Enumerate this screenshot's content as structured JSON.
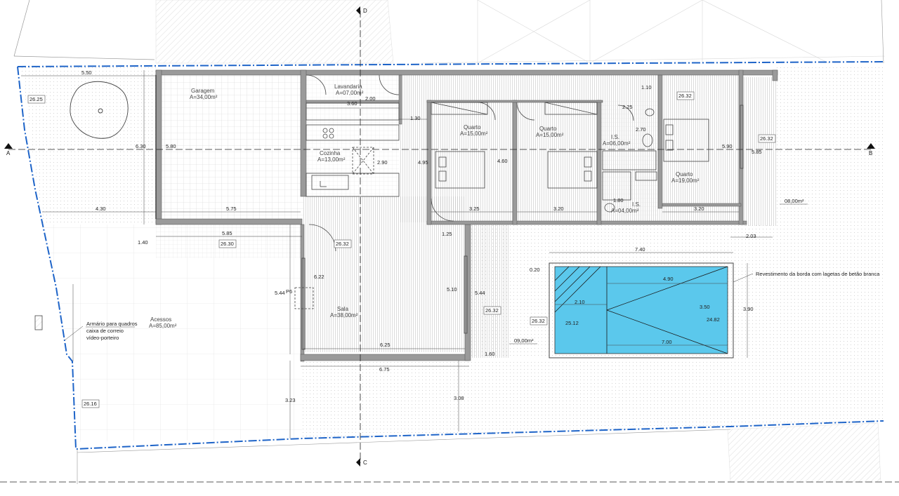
{
  "sections": {
    "a": "A",
    "b": "B",
    "c": "C",
    "d": "D"
  },
  "rooms": {
    "garagem": {
      "name": "Garagem",
      "area": "A=34,00m²"
    },
    "lavandaria": {
      "name": "Lavandaria",
      "area": "A=07,00m²"
    },
    "cozinha": {
      "name": "Cozinha",
      "area": "A=13,00m²"
    },
    "quarto1": {
      "name": "Quarto",
      "area": "A=15,00m²"
    },
    "quarto2": {
      "name": "Quarto",
      "area": "A=15,00m²"
    },
    "is1": {
      "name": "I.S.",
      "area": "A=06,00m²"
    },
    "is2": {
      "name": "I.S.",
      "area": "A=04,00m²"
    },
    "quarto3": {
      "name": "Quarto",
      "area": "A=19,00m²"
    },
    "sala": {
      "name": "Sala",
      "area": "A=38,00m²"
    },
    "acessos": {
      "name": "Acessos",
      "area": "A=85,00m²"
    }
  },
  "notes": {
    "armario_line1": "Armário para quadros",
    "armario_line2": "caixa de correio",
    "armario_line3": "vídeo-porteiro",
    "revestimento": "Revestimento da borda com lagetas de betão branca",
    "door": "P6"
  },
  "areas": {
    "terrace": "08,00m²",
    "deck": "09,00m²"
  },
  "levels": {
    "l1": "26.25",
    "l2": "26.30",
    "l3": "26.32",
    "l4": "26.32",
    "l5": "26.32",
    "l6": "26.32",
    "l7": "26.16",
    "l8": "26.32",
    "l9": "25.12",
    "l10": "24.82"
  },
  "dims": {
    "d550": "5.50",
    "d630": "6.30",
    "d580": "5.80",
    "d430": "4.30",
    "d575": "5.75",
    "d585": "5.85",
    "d140": "1.40",
    "d360": "3.60",
    "d200": "2.00",
    "d130": "1.30",
    "d290": "2.90",
    "d495": "4.95",
    "d460": "4.60",
    "d325": "3.25",
    "d320a": "3.20",
    "d225": "2.25",
    "d270": "2.70",
    "d110": "1.10",
    "d180": "1.80",
    "d320b": "3.20",
    "d590": "5.90",
    "d585b": "5.85",
    "d203": "2.03",
    "d125": "1.25",
    "d622": "6.22",
    "d544a": "5.44",
    "d510": "5.10",
    "d544b": "5.44",
    "d625": "6.25",
    "d675": "6.75",
    "d160": "1.60",
    "d323": "3.23",
    "d308": "3.08",
    "d740": "7.40",
    "d020": "0.20",
    "d490": "4.90",
    "d210": "2.10",
    "d350": "3.50",
    "d390": "3.90",
    "d700": "7.00"
  },
  "colors": {
    "pool": "#5bc8ec",
    "boundary": "#1e64c8",
    "wall": "#9a9a9a"
  }
}
